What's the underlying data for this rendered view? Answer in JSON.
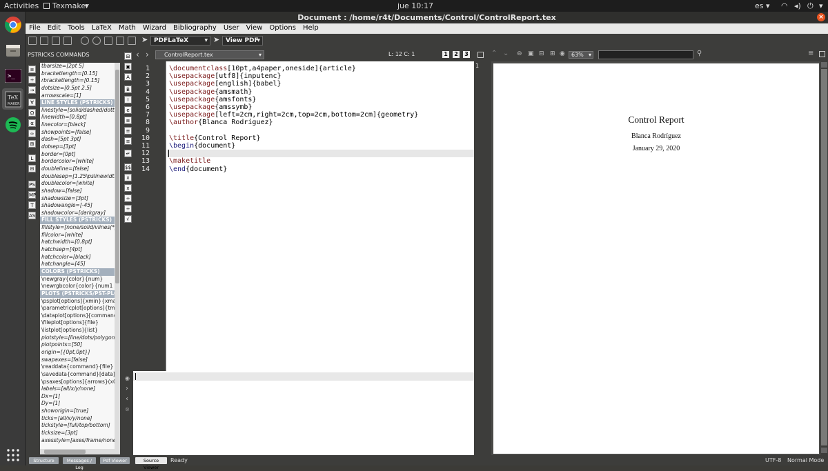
{
  "topbar": {
    "activities": "Activities",
    "app_menu": "Texmaker",
    "clock": "jue 10:17",
    "lang": "es"
  },
  "window": {
    "title": "Document : /home/r4t/Documents/Control/ControlReport.tex"
  },
  "menu": [
    "File",
    "Edit",
    "Tools",
    "LaTeX",
    "Math",
    "Wizard",
    "Bibliography",
    "User",
    "View",
    "Options",
    "Help"
  ],
  "toolbar": {
    "compile_combo": "PDFLaTeX",
    "view_combo": "View PDF"
  },
  "structure": {
    "title": "PSTRICKS COMMANDS",
    "items": [
      {
        "t": "tbarsize=[2pt 5]",
        "k": "i"
      },
      {
        "t": "bracketlength=[0.15]",
        "k": "i"
      },
      {
        "t": "rbracketlength=[0.15]",
        "k": "i"
      },
      {
        "t": "dotsize=[0.5pt 2.5]",
        "k": "i"
      },
      {
        "t": "arrowscale=[1]",
        "k": "i"
      },
      {
        "t": "LINE STYLES  (PSTRICKS)",
        "k": "s"
      },
      {
        "t": "linestyle=[solid/dashed/dotted]",
        "k": "i"
      },
      {
        "t": "linewidth=[0.8pt]",
        "k": "i"
      },
      {
        "t": "linecolor=[black]",
        "k": "i"
      },
      {
        "t": "showpoints=[false]",
        "k": "i"
      },
      {
        "t": "dash=[5pt 3pt]",
        "k": "i"
      },
      {
        "t": "dotsep=[3pt]",
        "k": "i"
      },
      {
        "t": "border=[0pt]",
        "k": "i"
      },
      {
        "t": "bordercolor=[white]",
        "k": "i"
      },
      {
        "t": "doubleline=[false]",
        "k": "i"
      },
      {
        "t": "doublesep=[1.25\\pslinewidth]",
        "k": "i"
      },
      {
        "t": "doublecolor=[white]",
        "k": "i"
      },
      {
        "t": "shadow=[false]",
        "k": "i"
      },
      {
        "t": "shadowsize=[3pt]",
        "k": "i"
      },
      {
        "t": "shadowangle=[-45]",
        "k": "i"
      },
      {
        "t": "shadowcolor=[darkgray]",
        "k": "i"
      },
      {
        "t": "FILL STYLES  (PSTRICKS)",
        "k": "s"
      },
      {
        "t": "fillstyle=[none/solid/vlines(*)",
        "k": "i"
      },
      {
        "t": "fillcolor=[white]",
        "k": "i"
      },
      {
        "t": "hatchwidth=[0.8pt]",
        "k": "i"
      },
      {
        "t": "hatchsep=[4pt]",
        "k": "i"
      },
      {
        "t": "hatchcolor=[black]",
        "k": "i"
      },
      {
        "t": "hatchangle=[45]",
        "k": "i"
      },
      {
        "t": "COLORS  (PSTRICKS)",
        "k": "s"
      },
      {
        "t": "\\newgray{color}{num}",
        "k": "n"
      },
      {
        "t": "\\newrgbcolor{color}{num1 num2",
        "k": "n"
      },
      {
        "t": "PLOTS (PSTRICKS/PST-PLOT)",
        "k": "s"
      },
      {
        "t": "\\psplot[options]{xmin}{xmax}",
        "k": "n"
      },
      {
        "t": "\\parametricplot[options]{tmin}",
        "k": "n"
      },
      {
        "t": "\\dataplot[options]{commands}",
        "k": "n"
      },
      {
        "t": "\\fileplot[options]{file}",
        "k": "n"
      },
      {
        "t": "\\listplot[options]{list}",
        "k": "n"
      },
      {
        "t": "plotstyle=[line/dots/polygon/",
        "k": "i"
      },
      {
        "t": "plotpoints=[50]",
        "k": "i"
      },
      {
        "t": "origin=[{0pt,0pt}]",
        "k": "i"
      },
      {
        "t": "swapaxes=[false]",
        "k": "i"
      },
      {
        "t": "\\readdata{command}{file}",
        "k": "n"
      },
      {
        "t": "\\savedata{command}[data]",
        "k": "n"
      },
      {
        "t": "\\psaxes[options]{arrows}(x0,y0)",
        "k": "n"
      },
      {
        "t": "labels=[all/x/y/none]",
        "k": "i"
      },
      {
        "t": "Dx=[1]",
        "k": "i"
      },
      {
        "t": "Dy=[1]",
        "k": "i"
      },
      {
        "t": "showorigin=[true]",
        "k": "i"
      },
      {
        "t": "ticks=[all/x/y/none]",
        "k": "i"
      },
      {
        "t": "tickstyle=[full/top/bottom]",
        "k": "i"
      },
      {
        "t": "ticksize=[3pt]",
        "k": "i"
      },
      {
        "t": "axesstyle=[axes/frame/none]",
        "k": "i"
      }
    ]
  },
  "editor": {
    "file_combo": "ControlReport.tex",
    "cursor": "L: 12 C: 1",
    "view_buttons": [
      "1",
      "2",
      "3"
    ],
    "lines": [
      {
        "n": "1",
        "cmd": "\\documentclass",
        "rest": "[10pt,a4paper,oneside]{article}",
        "c": "kw"
      },
      {
        "n": "2",
        "cmd": "\\usepackage",
        "rest": "[utf8]{inputenc}",
        "c": "kw"
      },
      {
        "n": "3",
        "cmd": "\\usepackage",
        "rest": "[english]{babel}",
        "c": "kw"
      },
      {
        "n": "4",
        "cmd": "\\usepackage",
        "rest": "{amsmath}",
        "c": "kw"
      },
      {
        "n": "5",
        "cmd": "\\usepackage",
        "rest": "{amsfonts}",
        "c": "kw"
      },
      {
        "n": "6",
        "cmd": "\\usepackage",
        "rest": "{amssymb}",
        "c": "kw"
      },
      {
        "n": "7",
        "cmd": "\\usepackage",
        "rest": "[left=2cm,right=2cm,top=2cm,bottom=2cm]{geometry}",
        "c": "kw"
      },
      {
        "n": "8",
        "cmd": "\\author",
        "rest": "{Blanca Rodríguez}",
        "c": "kw"
      },
      {
        "n": "9",
        "cmd": "",
        "rest": "",
        "c": "kw"
      },
      {
        "n": "10",
        "cmd": "\\title",
        "rest": "{Control Report}",
        "c": "kw"
      },
      {
        "n": "11",
        "cmd": "\\begin",
        "rest": "{document}",
        "c": "kb"
      },
      {
        "n": "12",
        "cmd": "",
        "rest": "",
        "c": "kw"
      },
      {
        "n": "13",
        "cmd": "\\maketitle",
        "rest": "",
        "c": "kw"
      },
      {
        "n": "14",
        "cmd": "\\end",
        "rest": "{document}",
        "c": "kb"
      }
    ]
  },
  "pdf": {
    "zoom": "63%",
    "page_num": "1",
    "title": "Control Report",
    "author": "Blanca Rodríguez",
    "date": "January 29, 2020"
  },
  "status": {
    "tabs": [
      "Structure",
      "Messages / Log",
      "Pdf Viewer",
      "Source Viewer"
    ],
    "ready": "Ready",
    "encoding": "UTF-8",
    "mode": "Normal Mode"
  },
  "colors": {
    "accent": "#e95420",
    "section_bg": "#a4b0bd"
  }
}
